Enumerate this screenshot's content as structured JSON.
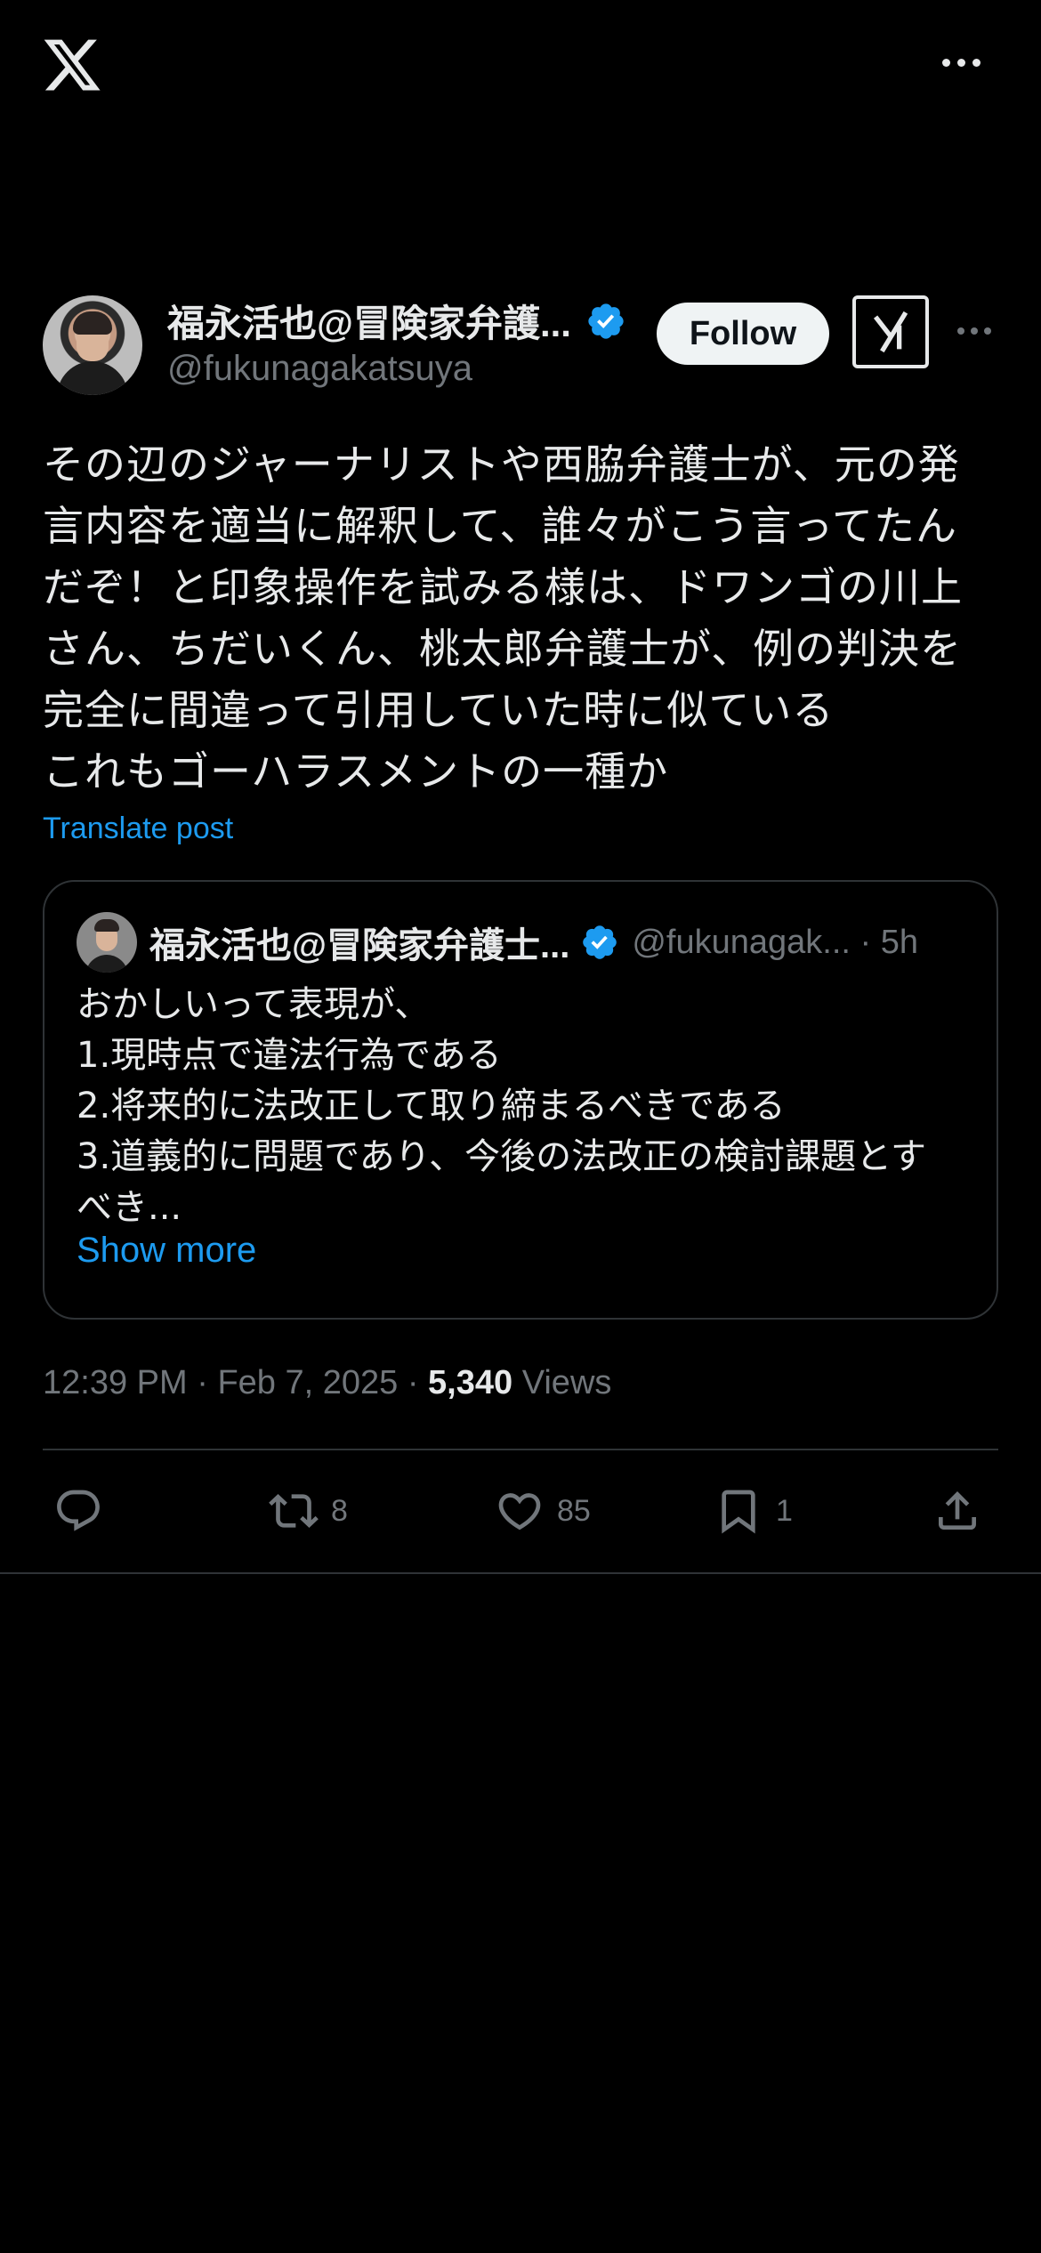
{
  "post": {
    "author_name": "福永活也@冒険家弁護...",
    "handle": "@fukunagakatsuya",
    "follow_label": "Follow",
    "text": "その辺のジャーナリストや西脇弁護士が、元の発\n言内容を適当に解釈して、誰々がこう言ってたん\nだぞ！と印象操作を試みる様は、ドワンゴの川上\nさん、ちだいくん、桃太郎弁護士が、例の判決を\n完全に間違って引用していた時に似ている\nこれもゴーハラスメントの一種か",
    "translate_label": "Translate post",
    "time": "12:39 PM",
    "date": "Feb 7, 2025",
    "views_count": "5,340",
    "views_label": "Views"
  },
  "quote": {
    "author_name": "福永活也@冒険家弁護士...",
    "handle": "@fukunagak...",
    "age": "5h",
    "text": "おかしいって表現が、\n1.現時点で違法行為である\n2.将来的に法改正して取り締まるべきである\n3.道義的に問題であり、今後の法改正の検討課題とす\nべき...",
    "show_more_label": "Show more"
  },
  "actions": {
    "reposts": "8",
    "likes": "85",
    "bookmarks": "1"
  },
  "colors": {
    "background": "#000000",
    "text": "#e7e9ea",
    "muted": "#71767b",
    "link": "#1d9bf0",
    "verified": "#1d9bf0",
    "border": "#2f3336"
  },
  "icons": [
    "x-logo-icon",
    "more-icon",
    "verified-badge-icon",
    "grok-icon",
    "reply-icon",
    "repost-icon",
    "like-icon",
    "bookmark-icon",
    "share-icon"
  ]
}
